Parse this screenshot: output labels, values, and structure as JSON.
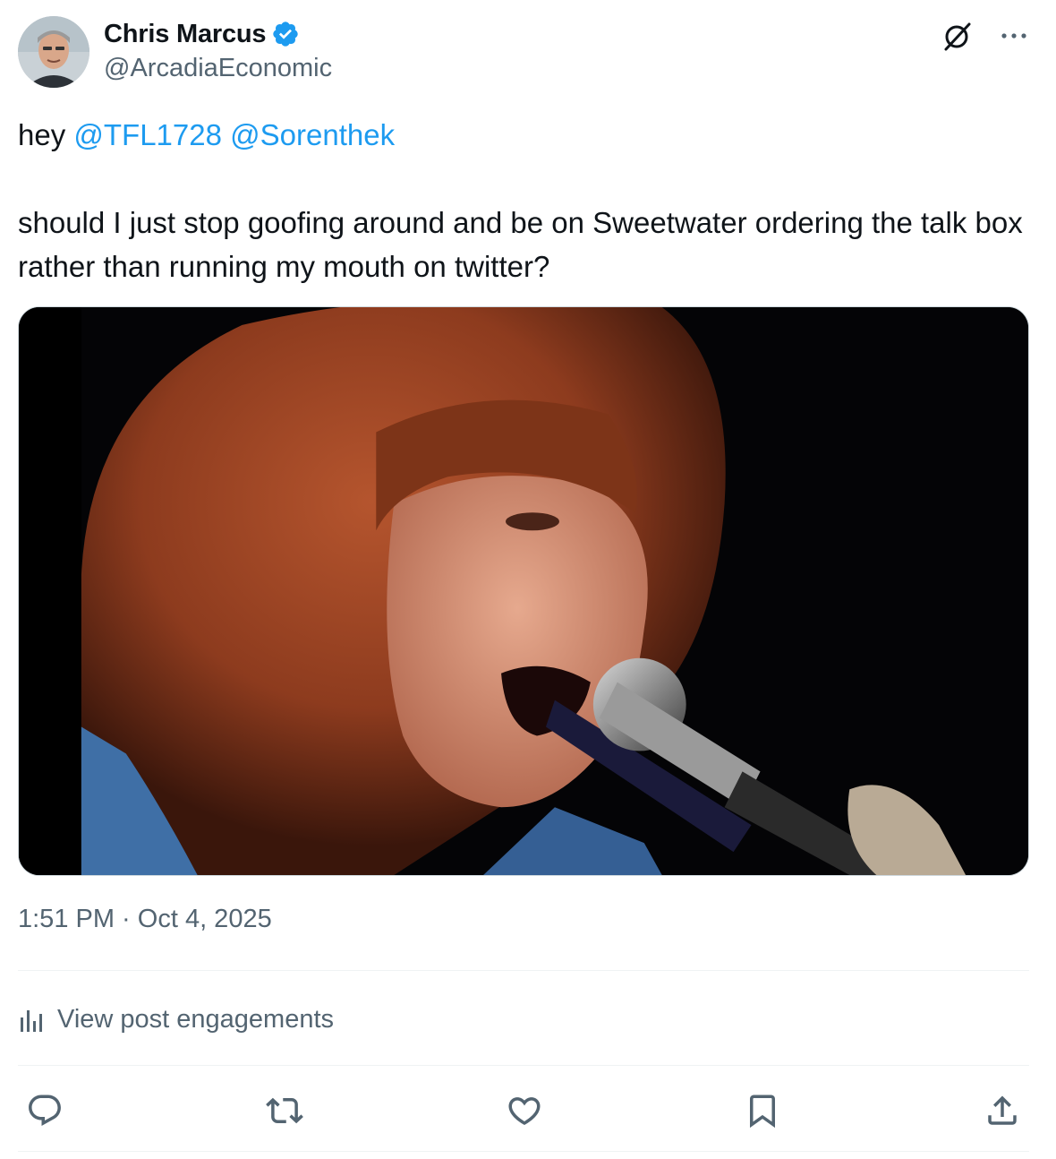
{
  "author": {
    "display_name": "Chris Marcus",
    "handle": "@ArcadiaEconomic",
    "verified": true
  },
  "tweet": {
    "line1_prefix": "hey ",
    "mentions": [
      "@TFL1728",
      "@Sorenthek"
    ],
    "body": "should I just stop goofing around and be on Sweetwater ordering the talk box rather than running my mouth on twitter?",
    "timestamp": "1:51 PM · Oct 4, 2025"
  },
  "engagements": {
    "label": "View post engagements"
  },
  "actions": {
    "reply_icon": "reply-icon",
    "retweet_icon": "retweet-icon",
    "like_icon": "heart-icon",
    "bookmark_icon": "bookmark-icon",
    "share_icon": "share-icon"
  },
  "colors": {
    "accent": "#1d9bf0",
    "text": "#0f1419",
    "secondary": "#536471",
    "divider": "#eff3f4"
  }
}
